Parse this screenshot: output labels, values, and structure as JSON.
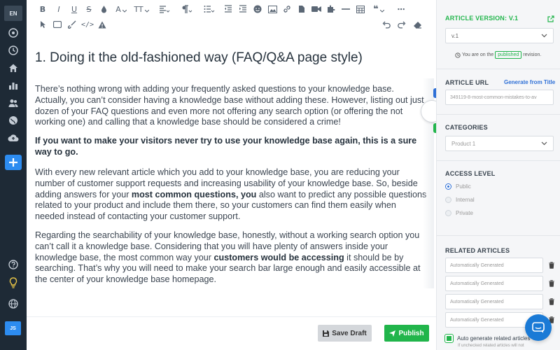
{
  "rail": {
    "lang": "EN",
    "user_initials": "JS",
    "icons": [
      "dashboard-icon",
      "history-icon",
      "home-icon",
      "analytics-icon",
      "users-icon",
      "globe-icon",
      "cloud-upload-icon",
      "plus-icon",
      "help-icon",
      "lightbulb-icon",
      "world-icon"
    ]
  },
  "toolbar": {
    "font_label": "A",
    "size_label": "TT",
    "row1": [
      "bold",
      "italic",
      "underline",
      "strikethrough",
      "color",
      "font",
      "size",
      "align",
      "paragraph",
      "list",
      "outdent",
      "indent",
      "emoticon",
      "image",
      "link",
      "file",
      "video",
      "plugin",
      "hr",
      "table",
      "quote"
    ],
    "row2": [
      "select",
      "box",
      "paint",
      "code",
      "warning",
      "undo",
      "redo",
      "eraser"
    ]
  },
  "editor": {
    "heading": "1. Doing it the old-fashioned way (FAQ/Q&A page style)",
    "p1": "There’s nothing wrong with adding your frequently asked questions to your knowledge base. Actually, you can’t consider having a knowledge base without adding these. However, listing out just dozen of your FAQ questions and even more not offering any search option (or offering the not working one) and calling that a knowledge base should be considered a crime!",
    "p2_bold": "If you want to make your visitors never try to use your knowledge base again, this is a sure way to go.",
    "p3_a": "With every new relevant article which you add to your knowledge base, you are reducing your number of customer support requests and increasing usability of your knowledge base. So, beside adding answers for your ",
    "p3_bold": "most common questions, you",
    "p3_b": " also want to predict any possible questions related to your product and include them there, so your customers can find them easily when needed instead of contacting your customer support.",
    "p4_a": "Regarding the searchability of your knowledge base, honestly, without a working search option you can’t call it a knowledge base. Considering that you will have plenty of answers inside your knowledge base, the most common way your ",
    "p4_bold": "customers would be accessing",
    "p4_b": " it should be by searching. That’s why you will need to make your search bar large enough and easily accessible at the center of your knowledge base homepage."
  },
  "footer": {
    "save_draft": "Save Draft",
    "publish": "Publish"
  },
  "sidebar": {
    "version_title": "ARTICLE VERSION: V.1",
    "version_value": "v.1",
    "revision_prefix": "You are on the",
    "revision_badge": "published",
    "revision_suffix": "revision.",
    "url_title": "ARTICLE URL",
    "url_link": "Generate from Title",
    "url_value": "349119-8-most-common-mistakes-to-av",
    "categories_title": "CATEGORIES",
    "category_value": "Product 1",
    "access_title": "ACCESS LEVEL",
    "access_options": [
      "Public",
      "Internal",
      "Private"
    ],
    "access_selected": "Public",
    "related_title": "RELATED ARTICLES",
    "related_placeholders": [
      "Automatically Generated",
      "Automatically Generated",
      "Automatically Generated",
      "Automatically Generated"
    ],
    "auto_label": "Auto generate related articles",
    "auto_note": "If unchecked related articles will not"
  },
  "colors": {
    "rail_bg": "#1e2a36",
    "accent_blue": "#2d8cf0",
    "success_green": "#21b54b",
    "link_blue": "#2d6fd6",
    "chat_blue": "#1a7ad6"
  }
}
